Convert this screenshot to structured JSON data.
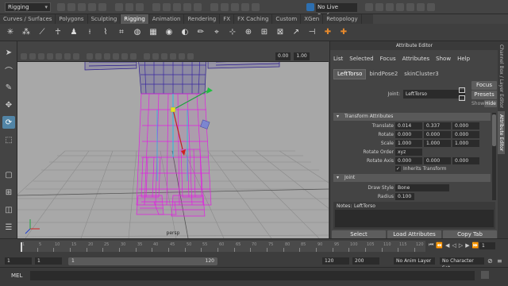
{
  "status_line": {
    "mode": "Rigging",
    "live_surface": "No Live Surface"
  },
  "shelf": {
    "tabs": [
      "Curves / Surfaces",
      "Polygons",
      "Sculpting",
      "Rigging",
      "Animation",
      "Rendering",
      "FX",
      "FX Caching",
      "Custom",
      "XGen",
      "Retopology"
    ],
    "active_tab": "Rigging"
  },
  "viewport": {
    "camera_label": "persp",
    "field_1": "0.00",
    "field_2": "1.00"
  },
  "attribute_editor": {
    "title": "Attribute Editor",
    "menu": [
      "List",
      "Selected",
      "Focus",
      "Attributes",
      "Show",
      "Help"
    ],
    "tabs": [
      "LeftTorso",
      "bindPose2",
      "skinCluster3"
    ],
    "active_tab": "LeftTorso",
    "joint_label": "Joint:",
    "joint_name": "LeftTorso",
    "focus_button": "Focus",
    "presets_button": "Presets",
    "show_label": "Show",
    "hide_button": "Hide",
    "transform_section": "Transform Attributes",
    "translate_label": "Translate",
    "translate": [
      "0.014",
      "0.337",
      "0.000"
    ],
    "rotate_label": "Rotate",
    "rotate": [
      "0.000",
      "0.000",
      "0.000"
    ],
    "scale_label": "Scale",
    "scale": [
      "1.000",
      "1.000",
      "1.000"
    ],
    "rotate_order_label": "Rotate Order",
    "rotate_order": "xyz",
    "rotate_axis_label": "Rotate Axis",
    "rotate_axis": [
      "0.000",
      "0.000",
      "0.000"
    ],
    "inherits_transform": "Inherits Transform",
    "joint_section": "Joint",
    "draw_style_label": "Draw Style",
    "draw_style": "Bone",
    "radius_label": "Radius",
    "radius": "0.100",
    "notes_label": "Notes:",
    "notes_name": "LeftTorso",
    "select_button": "Select",
    "load_attributes_button": "Load Attributes",
    "copy_tab_button": "Copy Tab"
  },
  "side_tabs": [
    "Channel Box / Layer Editor",
    "Attribute Editor"
  ],
  "time_slider": {
    "ticks": [
      "1",
      "5",
      "10",
      "15",
      "20",
      "25",
      "30",
      "35",
      "40",
      "45",
      "50",
      "55",
      "60",
      "65",
      "70",
      "75",
      "80",
      "85",
      "90",
      "95",
      "100",
      "105",
      "110",
      "115",
      "120"
    ],
    "current_frame": "1"
  },
  "range_slider": {
    "start": "1",
    "playback_start": "1",
    "range_start_label": "1",
    "range_end_label": "120",
    "playback_end": "120",
    "end": "200",
    "anim_layer": "No Anim Layer",
    "character_set": "No Character Set"
  },
  "command_line": {
    "label": "MEL"
  },
  "colors": {
    "accent": "#5285a6",
    "wireframe_mesh": "#e020e0",
    "wireframe_dark": "#2a1a8c",
    "viewport_bg": "#a8a8a8"
  }
}
